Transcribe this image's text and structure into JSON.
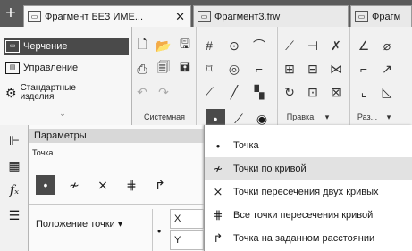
{
  "tabs": [
    {
      "label": "Фрагмент БЕЗ ИМЕ...",
      "icon": "fragment-icon",
      "close": "✕"
    },
    {
      "label": "Фрагмент3.frw",
      "icon": "fragment-icon"
    },
    {
      "label": "Фрагм",
      "icon": "fragment-icon"
    }
  ],
  "new_tab_symbol": "+",
  "modes": [
    {
      "label": "Черчение",
      "selected": true
    },
    {
      "label": "Управление",
      "selected": false
    },
    {
      "label": "Стандартные изделия",
      "selected": false
    }
  ],
  "collapse_symbol": "⌄",
  "toolbar": {
    "system_label": "Системная",
    "edit_label": "Правка",
    "size_label": "Раз..."
  },
  "params": {
    "title": "Параметры",
    "subtitle": "Точка",
    "position_label": "Положение точки",
    "x_label": "X",
    "y_label": "Y"
  },
  "menu": {
    "items": [
      {
        "label": "Точка",
        "icon": "point-icon",
        "highlighted": false
      },
      {
        "label": "Точки по кривой",
        "icon": "points-on-curve-icon",
        "highlighted": true
      },
      {
        "label": "Точки пересечения двух кривых",
        "icon": "two-curves-intersection-icon",
        "highlighted": false
      },
      {
        "label": "Все точки пересечения кривой",
        "icon": "all-intersections-icon",
        "highlighted": false
      },
      {
        "label": "Точка на заданном расстоянии",
        "icon": "point-at-distance-icon",
        "highlighted": false
      }
    ]
  }
}
